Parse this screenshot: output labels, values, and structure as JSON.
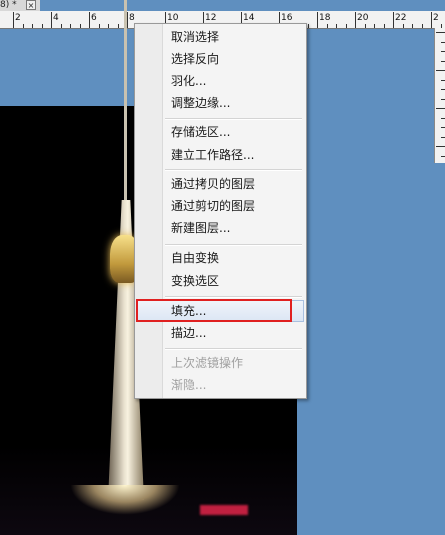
{
  "tab": {
    "title": "8) *",
    "close_glyph": "×"
  },
  "ruler": {
    "labels": [
      "2",
      "4",
      "6",
      "8",
      "10",
      "12",
      "14",
      "16",
      "18",
      "20",
      "22",
      "2"
    ]
  },
  "menu": {
    "items": [
      {
        "label": "取消选择",
        "enabled": true
      },
      {
        "label": "选择反向",
        "enabled": true
      },
      {
        "label": "羽化...",
        "enabled": true
      },
      {
        "label": "调整边缘...",
        "enabled": true
      },
      {
        "label": "存储选区...",
        "enabled": true
      },
      {
        "label": "建立工作路径...",
        "enabled": true
      },
      {
        "label": "通过拷贝的图层",
        "enabled": true
      },
      {
        "label": "通过剪切的图层",
        "enabled": true
      },
      {
        "label": "新建图层...",
        "enabled": true
      },
      {
        "label": "自由变换",
        "enabled": true
      },
      {
        "label": "变换选区",
        "enabled": true
      },
      {
        "label": "填充...",
        "enabled": true,
        "highlighted": true
      },
      {
        "label": "描边...",
        "enabled": true
      },
      {
        "label": "上次滤镜操作",
        "enabled": false
      },
      {
        "label": "渐隐...",
        "enabled": false
      }
    ]
  },
  "colors": {
    "workspace": "#5f8fbf",
    "highlight_border": "#e02020"
  }
}
